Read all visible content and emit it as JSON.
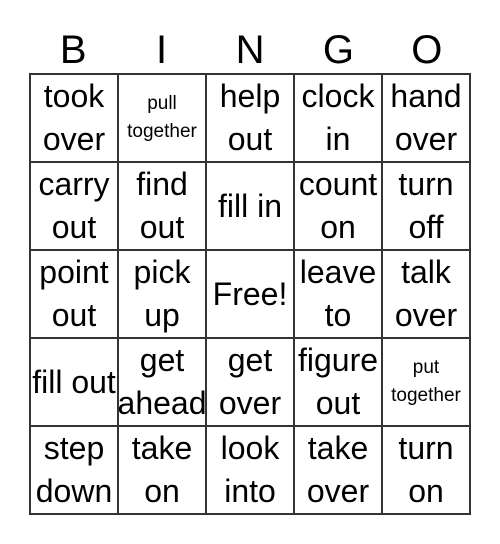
{
  "header": [
    "B",
    "I",
    "N",
    "G",
    "O"
  ],
  "cells": [
    {
      "text": "took over",
      "small": false
    },
    {
      "text": "pull together",
      "small": true
    },
    {
      "text": "help out",
      "small": false
    },
    {
      "text": "clock in",
      "small": false
    },
    {
      "text": "hand over",
      "small": false
    },
    {
      "text": "carry out",
      "small": false
    },
    {
      "text": "find out",
      "small": false
    },
    {
      "text": "fill in",
      "small": false
    },
    {
      "text": "count on",
      "small": false
    },
    {
      "text": "turn off",
      "small": false
    },
    {
      "text": "point out",
      "small": false
    },
    {
      "text": "pick up",
      "small": false
    },
    {
      "text": "Free!",
      "small": false
    },
    {
      "text": "leave to",
      "small": false
    },
    {
      "text": "talk over",
      "small": false
    },
    {
      "text": "fill out",
      "small": false
    },
    {
      "text": "get ahead",
      "small": false
    },
    {
      "text": "get over",
      "small": false
    },
    {
      "text": "figure out",
      "small": false
    },
    {
      "text": "put together",
      "small": true
    },
    {
      "text": "step down",
      "small": false
    },
    {
      "text": "take on",
      "small": false
    },
    {
      "text": "look into",
      "small": false
    },
    {
      "text": "take over",
      "small": false
    },
    {
      "text": "turn on",
      "small": false
    }
  ]
}
